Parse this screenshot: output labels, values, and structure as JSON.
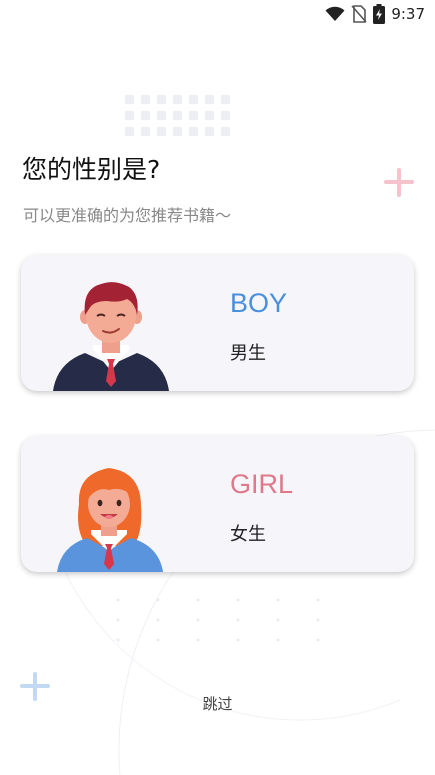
{
  "status_bar": {
    "time": "9:37",
    "icons": [
      "wifi-icon",
      "no-sim-icon",
      "battery-charging-icon"
    ]
  },
  "title": "您的性别是?",
  "subtitle": "可以更准确的为您推荐书籍～",
  "options": [
    {
      "en": "BOY",
      "zh": "男生",
      "accent": "#4a8fdc"
    },
    {
      "en": "GIRL",
      "zh": "女生",
      "accent": "#e0788a"
    }
  ],
  "skip_label": "跳过",
  "colors": {
    "card_bg": "#f6f6fa",
    "plus_pink": "#f6c3cd",
    "plus_blue": "#c3d8f2",
    "dot_grid": "#eceef3"
  }
}
